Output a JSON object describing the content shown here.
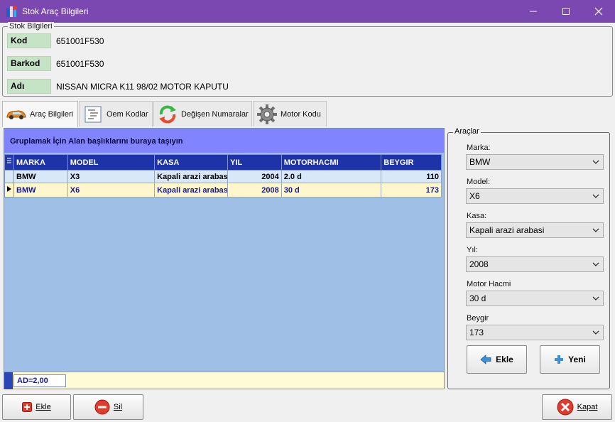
{
  "window": {
    "title": "Stok Araç Bilgileri"
  },
  "stok": {
    "legend": "Stok Bilgileri",
    "fields": [
      {
        "label": "Kod",
        "value": "651001F530"
      },
      {
        "label": "Barkod",
        "value": "651001F530"
      },
      {
        "label": "Adı",
        "value": "NISSAN MICRA K11 98/02 MOTOR KAPUTU"
      }
    ]
  },
  "tabs": [
    {
      "label": "Araç Bilgileri",
      "icon": "car-icon",
      "active": true
    },
    {
      "label": "Oem Kodlar",
      "icon": "list-tree-icon"
    },
    {
      "label": "Değişen Numaralar",
      "icon": "refresh-arrows-icon"
    },
    {
      "label": "Motor Kodu",
      "icon": "gear-icon"
    }
  ],
  "grid": {
    "group_header": "Gruplamak İçin Alan başlıklarını buraya taşıyın",
    "columns": [
      "MARKA",
      "MODEL",
      "KASA",
      "YIL",
      "MOTORHACMI",
      "BEYGIR"
    ],
    "rows": [
      [
        "BMW",
        "X3",
        "Kapali arazi arabası",
        "2004",
        "2.0 d",
        "110"
      ],
      [
        "BMW",
        "X6",
        "Kapali arazi arabası",
        "2008",
        "30 d",
        "173"
      ]
    ],
    "summary": "AD=2,00"
  },
  "araclar": {
    "legend": "Araçlar",
    "fields": [
      {
        "label": "Marka:",
        "value": "BMW"
      },
      {
        "label": "Model:",
        "value": "X6"
      },
      {
        "label": "Kasa:",
        "value": "Kapali arazi arabasi"
      },
      {
        "label": "Yıl:",
        "value": "2008"
      },
      {
        "label": "Motor Hacmi",
        "value": "30 d"
      },
      {
        "label": "Beygir",
        "value": "173"
      }
    ],
    "ekle_label": "Ekle",
    "yeni_label": "Yeni"
  },
  "bottom": {
    "ekle_label": "Ekle",
    "sil_label": "Sil",
    "kapat_label": "Kapat"
  },
  "colors": {
    "titlebar": "#7a48b0",
    "grid_header": "#1f33a8",
    "group_header": "#8184ff",
    "grid_background": "#9fbfe6"
  }
}
